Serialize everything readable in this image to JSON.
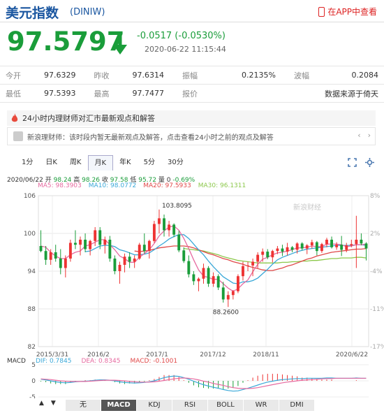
{
  "header": {
    "title": "美元指数",
    "symbol": "(DINIW)",
    "app_link": "在APP中查看"
  },
  "price": {
    "value": "97.5797",
    "change": "-0.0517 (-0.0530%)",
    "time": "2020-06-22 11:15:44"
  },
  "quote": {
    "rows": [
      [
        {
          "label": "今开",
          "value": "97.6329"
        },
        {
          "label": "昨收",
          "value": "97.6314"
        },
        {
          "label": "振幅",
          "value": "0.2135%"
        },
        {
          "label": "波幅",
          "value": "0.2084"
        }
      ],
      [
        {
          "label": "最低",
          "value": "97.5393"
        },
        {
          "label": "最高",
          "value": "97.7477"
        },
        {
          "label": "报价",
          "value": "数据来源于倚天"
        }
      ]
    ]
  },
  "opinion": {
    "title": "24小时内理财师对汇市最新观点和解答",
    "text": "新浪理财师：该时段内暂无最新观点及解答，点击查看24小时之前的观点及解答"
  },
  "chart_tabs": [
    "1分",
    "日K",
    "周K",
    "月K",
    "年K",
    "5分",
    "30分"
  ],
  "active_tab": "月K",
  "ohlc": {
    "date": "2020/06/22",
    "open_label": "开",
    "open": "98.24",
    "high_label": "高",
    "high": "98.26",
    "close_label": "收",
    "close": "97.58",
    "low_label": "低",
    "low": "95.72",
    "vol_label": "量",
    "vol": "0",
    "pct": "-0.69%"
  },
  "ma": [
    {
      "label": "MA5: 98.3903",
      "color": "#e66aa0"
    },
    {
      "label": "MA10: 98.0772",
      "color": "#3aa8d8"
    },
    {
      "label": "MA20: 97.5933",
      "color": "#e04848"
    },
    {
      "label": "MA30: 96.1311",
      "color": "#8cc84b"
    }
  ],
  "watermark": "新浪财经",
  "macd": {
    "label": "MACD",
    "dif": "DIF: 0.7845",
    "dea": "DEA: 0.8345",
    "macd": "MACD: -0.1001"
  },
  "bottom_tabs": [
    "无",
    "MACD",
    "KDJ",
    "RSI",
    "BOLL",
    "WR",
    "DMI"
  ],
  "bottom_active": "MACD",
  "nav": {
    "up": "▲",
    "down": "▼"
  },
  "chart_data": {
    "type": "candlestick",
    "y_ticks": [
      "106",
      "100",
      "94",
      "88",
      "82"
    ],
    "y_range": [
      82,
      106
    ],
    "pct_ticks": [
      "8%",
      "2%",
      "-4%",
      "-11%",
      "-17%"
    ],
    "x_labels": [
      "2015/3/31",
      "2016/2",
      "2017/1",
      "2017/12",
      "2018/11",
      "2020/6/22"
    ],
    "annotations": {
      "high": "103.8095",
      "low": "88.2600"
    },
    "macd_ticks": [
      "5",
      "0",
      "-5"
    ],
    "candles": [
      [
        98,
        100.5,
        97,
        97.2
      ],
      [
        97.2,
        98,
        95,
        95.8
      ],
      [
        95.8,
        97.5,
        95,
        97
      ],
      [
        97,
        98.2,
        95.5,
        96
      ],
      [
        96,
        97.5,
        93.5,
        94.5
      ],
      [
        94.5,
        96.5,
        93,
        96
      ],
      [
        96,
        99,
        95.5,
        98.5
      ],
      [
        98.5,
        100.5,
        97.5,
        98.2
      ],
      [
        98.2,
        99.5,
        96.5,
        99
      ],
      [
        99,
        100,
        97,
        97.5
      ],
      [
        97.5,
        99,
        96.5,
        98.8
      ],
      [
        98.8,
        101,
        98,
        100.5
      ],
      [
        100.5,
        101,
        97.5,
        98.2
      ],
      [
        98.2,
        99.5,
        96.8,
        99
      ],
      [
        99,
        99.6,
        95.5,
        96
      ],
      [
        96,
        96.5,
        93.5,
        94
      ],
      [
        94,
        95.5,
        92,
        95
      ],
      [
        95,
        96.8,
        93.8,
        96.3
      ],
      [
        96.3,
        97,
        94.5,
        95.5
      ],
      [
        95.5,
        96.5,
        94.5,
        96
      ],
      [
        96,
        98.5,
        95.8,
        98.2
      ],
      [
        98.2,
        100,
        96.8,
        97.2
      ],
      [
        97.2,
        99,
        96,
        98.8
      ],
      [
        98.8,
        102,
        98.5,
        101.5
      ],
      [
        101.5,
        103.8,
        100,
        102.4
      ],
      [
        102.4,
        103,
        99.5,
        100.5
      ],
      [
        100.5,
        102,
        99.5,
        101.4
      ],
      [
        101.4,
        101.6,
        99.4,
        99.8
      ],
      [
        99.8,
        100.4,
        97,
        97.3
      ],
      [
        97.3,
        97.8,
        95.3,
        95.6
      ],
      [
        95.6,
        96.5,
        93,
        93.5
      ],
      [
        93.5,
        94,
        91.8,
        92.4
      ],
      [
        92.4,
        93,
        90.8,
        92.8
      ],
      [
        92.8,
        95.2,
        92,
        94.5
      ],
      [
        94.5,
        94.8,
        91.5,
        92
      ],
      [
        92,
        93.8,
        91.5,
        93.2
      ],
      [
        93.2,
        93.5,
        91,
        91.4
      ],
      [
        91.4,
        92.3,
        89,
        89.5
      ],
      [
        89.5,
        90.8,
        88.3,
        90.2
      ],
      [
        90.2,
        91,
        89.5,
        90.8
      ],
      [
        90.8,
        93.5,
        90.5,
        93.2
      ],
      [
        93.2,
        95.5,
        92.5,
        94.8
      ],
      [
        94.8,
        95.5,
        94,
        94.9
      ],
      [
        94.9,
        96,
        93.2,
        95.5
      ],
      [
        95.5,
        97,
        94.5,
        96.6
      ],
      [
        96.6,
        97.6,
        95.5,
        97.1
      ],
      [
        97.1,
        97.5,
        95.9,
        96.2
      ],
      [
        96.2,
        97.4,
        95.4,
        97.2
      ],
      [
        97.2,
        98,
        96.7,
        97.6
      ],
      [
        97.6,
        98.2,
        96.4,
        97.1
      ],
      [
        97.1,
        98.5,
        96.5,
        97.8
      ],
      [
        97.8,
        98,
        97,
        97.4
      ],
      [
        97.4,
        98.6,
        96.8,
        98.4
      ],
      [
        98.4,
        98.6,
        97.3,
        97.6
      ],
      [
        97.6,
        98.3,
        96.7,
        98.1
      ],
      [
        98.1,
        99,
        97.6,
        98.6
      ],
      [
        98.6,
        98.8,
        96.5,
        97.2
      ],
      [
        97.2,
        98.5,
        96.9,
        98.3
      ],
      [
        98.3,
        99.3,
        97.8,
        99
      ],
      [
        99,
        99.5,
        97.6,
        97.8
      ],
      [
        97.8,
        98.6,
        97.4,
        98.2
      ],
      [
        98.2,
        99.6,
        96.4,
        97.4
      ],
      [
        97.4,
        98.5,
        97,
        98.1
      ],
      [
        98.1,
        99,
        97.8,
        98.3
      ],
      [
        98.3,
        102.8,
        94.5,
        99
      ],
      [
        99,
        100,
        98.1,
        98.4
      ],
      [
        98.4,
        98.6,
        95.7,
        97.6
      ]
    ],
    "ma5": [
      98,
      97.8,
      97,
      96.4,
      96,
      96,
      96.6,
      97,
      97.2,
      98,
      98.2,
      98.6,
      99,
      99,
      98.2,
      97.4,
      96.4,
      96,
      95.4,
      95.4,
      96.2,
      96.8,
      97.4,
      98.4,
      99.6,
      100.4,
      101,
      101.2,
      100.5,
      99.2,
      97.6,
      95.8,
      94.2,
      93.2,
      93,
      92.7,
      92.7,
      92,
      91.3,
      90.8,
      91.2,
      92,
      92.6,
      93.9,
      95.1,
      95.9,
      96.2,
      96.6,
      96.9,
      97,
      97.2,
      97.4,
      97.7,
      97.7,
      97.8,
      98,
      97.9,
      97.9,
      98.3,
      98.3,
      98.3,
      98.2,
      97.9,
      98,
      98.2,
      98.2,
      98.3
    ],
    "ma10": [
      null,
      null,
      null,
      null,
      null,
      null,
      null,
      null,
      null,
      97.1,
      97.2,
      97.6,
      98,
      98.1,
      98.1,
      97.9,
      97.4,
      97.2,
      96.9,
      96.6,
      96.6,
      96.7,
      96.9,
      97.4,
      98,
      98.5,
      99.1,
      99.5,
      99.8,
      99.8,
      99.2,
      98.3,
      97.4,
      96.6,
      95.6,
      94.7,
      93.9,
      93.1,
      92.6,
      92.1,
      92,
      92.3,
      92.3,
      92.5,
      92.9,
      93.6,
      94.3,
      95.1,
      95.8,
      96.2,
      96.5,
      96.8,
      97.1,
      97.3,
      97.5,
      97.6,
      97.7,
      97.8,
      97.9,
      98,
      98.1,
      98.1,
      98.1,
      98.1,
      98.2,
      98.2,
      98.1
    ],
    "ma20": [
      null,
      null,
      null,
      null,
      null,
      null,
      null,
      null,
      null,
      null,
      null,
      null,
      null,
      null,
      null,
      null,
      null,
      null,
      null,
      97.2,
      97.1,
      97.2,
      97.3,
      97.5,
      97.7,
      97.8,
      97.9,
      98,
      98,
      98,
      97.9,
      97.7,
      97.4,
      97.1,
      96.8,
      96.6,
      96.3,
      96,
      95.8,
      95.5,
      95.3,
      95.1,
      94.8,
      94.6,
      94.4,
      94.2,
      94.1,
      94.1,
      94.3,
      94.5,
      94.8,
      95,
      95.3,
      95.6,
      95.9,
      96.1,
      96.4,
      96.6,
      96.8,
      97,
      97.1,
      97.2,
      97.3,
      97.4,
      97.5,
      97.5,
      97.6
    ],
    "ma30": [
      null,
      null,
      null,
      null,
      null,
      null,
      null,
      null,
      null,
      null,
      null,
      null,
      null,
      null,
      null,
      null,
      null,
      null,
      null,
      null,
      null,
      null,
      null,
      null,
      null,
      null,
      null,
      null,
      null,
      97.6,
      97.5,
      97.4,
      97.3,
      97.2,
      97,
      96.8,
      96.6,
      96.3,
      96.1,
      95.9,
      95.7,
      95.6,
      95.5,
      95.4,
      95.3,
      95.3,
      95.3,
      95.3,
      95.3,
      95.4,
      95.4,
      95.5,
      95.5,
      95.6,
      95.6,
      95.7,
      95.7,
      95.8,
      95.9,
      96,
      96,
      96.1,
      96.1,
      96.1,
      96.2,
      96.2,
      96.1
    ],
    "dif": [
      0.5,
      0.3,
      0,
      -0.3,
      -0.5,
      -0.6,
      -0.5,
      -0.3,
      -0.2,
      -0.1,
      0,
      0.2,
      0.3,
      0.3,
      0.2,
      0,
      -0.3,
      -0.5,
      -0.6,
      -0.7,
      -0.6,
      -0.5,
      -0.3,
      0,
      0.5,
      1,
      1.3,
      1.5,
      1.4,
      1,
      0.5,
      -0.1,
      -0.7,
      -1.2,
      -1.6,
      -2,
      -2.3,
      -2.7,
      -3,
      -3.2,
      -3.1,
      -2.7,
      -2.3,
      -1.8,
      -1.3,
      -0.8,
      -0.4,
      -0.1,
      0.2,
      0.4,
      0.5,
      0.6,
      0.7,
      0.7,
      0.8,
      0.8,
      0.8,
      0.8,
      0.9,
      0.9,
      0.8,
      0.8,
      0.8,
      0.8,
      0.9,
      0.8,
      0.8
    ],
    "dea": [
      0.6,
      0.5,
      0.4,
      0.2,
      0,
      -0.1,
      -0.2,
      -0.2,
      -0.2,
      -0.2,
      -0.1,
      0,
      0.1,
      0.2,
      0.2,
      0.2,
      0.1,
      0,
      -0.2,
      -0.3,
      -0.4,
      -0.4,
      -0.4,
      -0.3,
      -0.1,
      0.1,
      0.4,
      0.6,
      0.8,
      0.9,
      0.8,
      0.6,
      0.3,
      -0.1,
      -0.4,
      -0.8,
      -1.1,
      -1.4,
      -1.8,
      -2.1,
      -2.3,
      -2.4,
      -2.4,
      -2.3,
      -2.1,
      -1.8,
      -1.5,
      -1.2,
      -0.9,
      -0.6,
      -0.4,
      -0.2,
      0,
      0.2,
      0.3,
      0.4,
      0.5,
      0.6,
      0.7,
      0.7,
      0.8,
      0.8,
      0.8,
      0.8,
      0.8,
      0.8,
      0.8
    ]
  }
}
